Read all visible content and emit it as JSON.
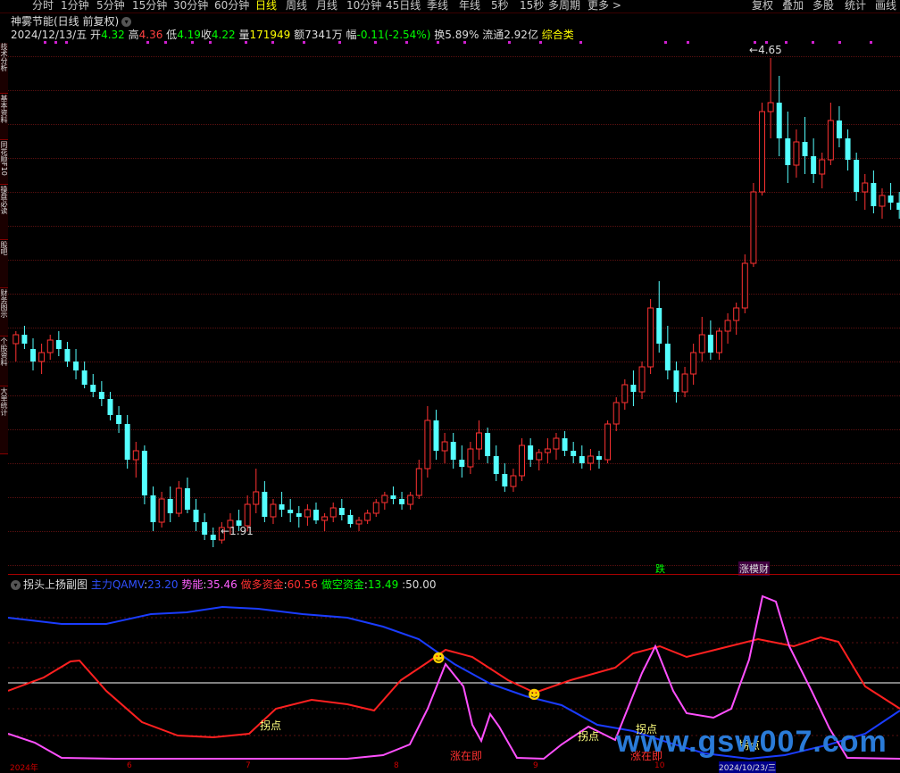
{
  "toolbar": {
    "tabs": [
      "分时",
      "1分钟",
      "5分钟",
      "15分钟",
      "30分钟",
      "60分钟",
      "日线",
      "周线",
      "月线",
      "10分钟",
      "45日线",
      "季线",
      "年线",
      "5秒",
      "15秒",
      "多周期",
      "更多 >"
    ],
    "active_tab": "日线",
    "right_buttons": [
      "复权",
      "叠加",
      "多股",
      "统计",
      "画线"
    ]
  },
  "sidebar": {
    "items": [
      "技术分析",
      "基本资料",
      "同花顺F10",
      "操盘必读",
      "股吧",
      "财务图示",
      "个股资料",
      "大单统计"
    ]
  },
  "main_chart": {
    "title": "神雾节能(日线 前复权)",
    "date": "2024/12/13/五",
    "open_label": "开",
    "open": "4.32",
    "high_label": "高",
    "high": "4.36",
    "low_label": "低",
    "low": "4.19",
    "close_label": "收",
    "close": "4.22",
    "volume_label": "量",
    "volume": "171949",
    "amount_label": "额",
    "amount": "7341万",
    "change_label": "幅",
    "change": "-0.11(-2.54%)",
    "turnover_label": "换",
    "turnover": "5.89%",
    "float_label": "流通",
    "float": "2.92亿",
    "category": "综合类",
    "max_price_label": "4.65",
    "min_price_label": "1.91",
    "signal_die": "跌",
    "signal_zhang": "涨模财"
  },
  "sub_chart": {
    "title": "拐头上扬副图",
    "line1_label": "主力QAMV",
    "line1_value": "23.20",
    "line2_label": "势能",
    "line2_value": "35.46",
    "line3_label": "做多资金",
    "line3_value": "60.56",
    "line4_label": "做空资金",
    "line4_value": "13.49",
    "line5_value": "50.00",
    "marker_guaidian": "拐点",
    "marker_zhangzaiji": "涨在即",
    "colors": {
      "blue": "#1a3cff",
      "red": "#ff2020",
      "magenta": "#ff50ff",
      "white": "#ffffff"
    }
  },
  "bottom_axis": {
    "labels": [
      "2024年",
      "6",
      "7",
      "8",
      "9",
      "10",
      "2024/10/23/三"
    ]
  },
  "watermark": "www.gsw007.com",
  "chart_data": {
    "type": "candlestick",
    "ohlc": [
      [
        3.05,
        3.12,
        2.95,
        3.1
      ],
      [
        3.1,
        3.15,
        3.02,
        3.05
      ],
      [
        3.02,
        3.08,
        2.9,
        2.95
      ],
      [
        2.95,
        3.05,
        2.88,
        3.0
      ],
      [
        3.0,
        3.1,
        2.96,
        3.07
      ],
      [
        3.07,
        3.12,
        2.98,
        3.02
      ],
      [
        3.02,
        3.06,
        2.92,
        2.95
      ],
      [
        2.95,
        3.02,
        2.85,
        2.9
      ],
      [
        2.9,
        2.95,
        2.8,
        2.82
      ],
      [
        2.82,
        2.88,
        2.75,
        2.78
      ],
      [
        2.78,
        2.84,
        2.7,
        2.74
      ],
      [
        2.74,
        2.78,
        2.62,
        2.65
      ],
      [
        2.65,
        2.7,
        2.55,
        2.6
      ],
      [
        2.6,
        2.65,
        2.35,
        2.4
      ],
      [
        2.4,
        2.5,
        2.3,
        2.45
      ],
      [
        2.45,
        2.48,
        2.15,
        2.2
      ],
      [
        2.2,
        2.25,
        2.0,
        2.05
      ],
      [
        2.05,
        2.22,
        2.02,
        2.18
      ],
      [
        2.18,
        2.25,
        2.05,
        2.1
      ],
      [
        2.1,
        2.28,
        2.08,
        2.24
      ],
      [
        2.24,
        2.3,
        2.1,
        2.12
      ],
      [
        2.12,
        2.18,
        2.0,
        2.05
      ],
      [
        2.05,
        2.1,
        1.95,
        1.98
      ],
      [
        1.98,
        2.02,
        1.91,
        1.95
      ],
      [
        1.95,
        2.05,
        1.93,
        2.02
      ],
      [
        2.02,
        2.1,
        1.98,
        2.06
      ],
      [
        2.06,
        2.12,
        2.0,
        2.03
      ],
      [
        2.03,
        2.2,
        2.0,
        2.15
      ],
      [
        2.15,
        2.35,
        2.1,
        2.22
      ],
      [
        2.22,
        2.28,
        2.05,
        2.08
      ],
      [
        2.08,
        2.18,
        2.04,
        2.15
      ],
      [
        2.15,
        2.22,
        2.08,
        2.12
      ],
      [
        2.12,
        2.18,
        2.05,
        2.1
      ],
      [
        2.1,
        2.14,
        2.02,
        2.08
      ],
      [
        2.08,
        2.15,
        2.03,
        2.12
      ],
      [
        2.12,
        2.16,
        2.04,
        2.06
      ],
      [
        2.06,
        2.1,
        2.0,
        2.08
      ],
      [
        2.08,
        2.16,
        2.05,
        2.13
      ],
      [
        2.13,
        2.18,
        2.06,
        2.09
      ],
      [
        2.09,
        2.12,
        2.02,
        2.04
      ],
      [
        2.04,
        2.08,
        2.0,
        2.06
      ],
      [
        2.06,
        2.12,
        2.04,
        2.1
      ],
      [
        2.1,
        2.18,
        2.08,
        2.16
      ],
      [
        2.16,
        2.22,
        2.12,
        2.2
      ],
      [
        2.2,
        2.25,
        2.15,
        2.18
      ],
      [
        2.18,
        2.22,
        2.12,
        2.15
      ],
      [
        2.15,
        2.22,
        2.12,
        2.2
      ],
      [
        2.2,
        2.4,
        2.18,
        2.35
      ],
      [
        2.35,
        2.7,
        2.3,
        2.62
      ],
      [
        2.62,
        2.68,
        2.4,
        2.45
      ],
      [
        2.45,
        2.55,
        2.38,
        2.5
      ],
      [
        2.5,
        2.55,
        2.35,
        2.4
      ],
      [
        2.4,
        2.48,
        2.3,
        2.36
      ],
      [
        2.36,
        2.5,
        2.32,
        2.46
      ],
      [
        2.46,
        2.62,
        2.4,
        2.55
      ],
      [
        2.55,
        2.58,
        2.38,
        2.42
      ],
      [
        2.42,
        2.48,
        2.28,
        2.32
      ],
      [
        2.32,
        2.38,
        2.22,
        2.25
      ],
      [
        2.25,
        2.35,
        2.22,
        2.31
      ],
      [
        2.31,
        2.52,
        2.28,
        2.48
      ],
      [
        2.48,
        2.52,
        2.36,
        2.4
      ],
      [
        2.4,
        2.46,
        2.34,
        2.44
      ],
      [
        2.44,
        2.52,
        2.38,
        2.46
      ],
      [
        2.46,
        2.55,
        2.4,
        2.52
      ],
      [
        2.52,
        2.56,
        2.42,
        2.45
      ],
      [
        2.45,
        2.5,
        2.38,
        2.42
      ],
      [
        2.42,
        2.48,
        2.35,
        2.38
      ],
      [
        2.38,
        2.46,
        2.34,
        2.42
      ],
      [
        2.42,
        2.45,
        2.35,
        2.4
      ],
      [
        2.4,
        2.62,
        2.38,
        2.6
      ],
      [
        2.6,
        2.75,
        2.56,
        2.72
      ],
      [
        2.72,
        2.85,
        2.68,
        2.82
      ],
      [
        2.82,
        2.9,
        2.7,
        2.78
      ],
      [
        2.78,
        2.95,
        2.74,
        2.92
      ],
      [
        2.92,
        3.3,
        2.88,
        3.25
      ],
      [
        3.25,
        3.4,
        3.0,
        3.05
      ],
      [
        3.05,
        3.15,
        2.85,
        2.9
      ],
      [
        2.9,
        2.95,
        2.72,
        2.78
      ],
      [
        2.78,
        2.92,
        2.75,
        2.88
      ],
      [
        2.88,
        3.05,
        2.82,
        3.0
      ],
      [
        3.0,
        3.2,
        2.95,
        3.1
      ],
      [
        3.1,
        3.18,
        2.96,
        3.0
      ],
      [
        3.0,
        3.14,
        2.96,
        3.12
      ],
      [
        3.12,
        3.22,
        3.05,
        3.18
      ],
      [
        3.18,
        3.28,
        3.1,
        3.25
      ],
      [
        3.25,
        3.55,
        3.22,
        3.5
      ],
      [
        3.5,
        3.95,
        3.48,
        3.9
      ],
      [
        3.9,
        4.4,
        3.88,
        4.35
      ],
      [
        4.35,
        4.65,
        4.2,
        4.4
      ],
      [
        4.4,
        4.55,
        4.1,
        4.2
      ],
      [
        4.2,
        4.35,
        3.95,
        4.05
      ],
      [
        4.05,
        4.25,
        3.98,
        4.18
      ],
      [
        4.18,
        4.32,
        4.0,
        4.1
      ],
      [
        4.1,
        4.2,
        3.95,
        4.0
      ],
      [
        4.0,
        4.12,
        3.92,
        4.08
      ],
      [
        4.08,
        4.4,
        4.05,
        4.3
      ],
      [
        4.3,
        4.38,
        4.15,
        4.2
      ],
      [
        4.2,
        4.25,
        4.02,
        4.08
      ],
      [
        4.08,
        4.12,
        3.85,
        3.9
      ],
      [
        3.9,
        4.0,
        3.8,
        3.95
      ],
      [
        3.95,
        4.02,
        3.78,
        3.82
      ],
      [
        3.82,
        3.92,
        3.75,
        3.88
      ],
      [
        3.88,
        3.95,
        3.8,
        3.84
      ],
      [
        3.84,
        3.9,
        3.75,
        3.8
      ]
    ],
    "price_range": [
      1.85,
      4.75
    ]
  }
}
